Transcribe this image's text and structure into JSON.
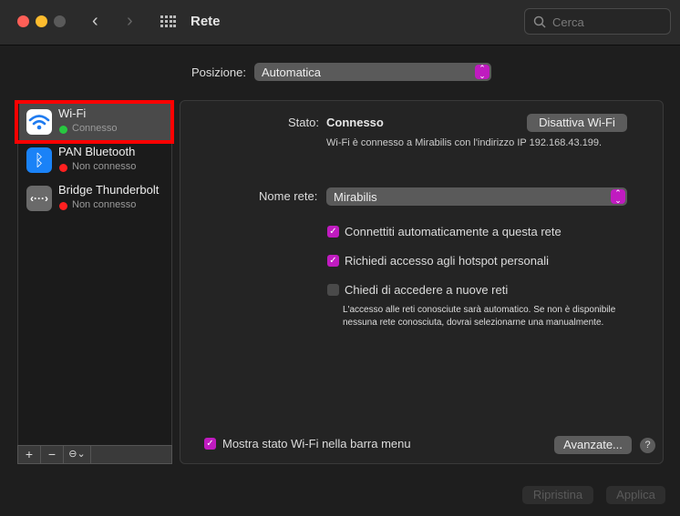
{
  "window": {
    "title": "Rete",
    "search_placeholder": "Cerca"
  },
  "location": {
    "label": "Posizione:",
    "value": "Automatica"
  },
  "services": [
    {
      "name": "Wi-Fi",
      "status": "Connesso",
      "status_color": "#28c840"
    },
    {
      "name": "PAN Bluetooth",
      "status": "Non connesso",
      "status_color": "#ff2020"
    },
    {
      "name": "Bridge Thunderbolt",
      "status": "Non connesso",
      "status_color": "#ff2020"
    }
  ],
  "sidebar_toolbar": {
    "add": "+",
    "remove": "−",
    "action": "⊖⌄"
  },
  "detail": {
    "status_label": "Stato:",
    "status_value": "Connesso",
    "toggle_button": "Disattiva Wi-Fi",
    "status_description": "Wi-Fi è connesso a Mirabilis con l'indirizzo IP 192.168.43.199.",
    "network_label": "Nome rete:",
    "network_value": "Mirabilis",
    "checkboxes": [
      {
        "label": "Connettiti automaticamente a questa rete",
        "checked": true
      },
      {
        "label": "Richiedi accesso agli hotspot personali",
        "checked": true
      },
      {
        "label": "Chiedi di accedere a nuove reti",
        "checked": false
      }
    ],
    "hint": "L'accesso alle reti conosciute sarà automatico. Se non è disponibile nessuna rete conosciuta, dovrai selezionarne una manualmente.",
    "menu_bar_checkbox": "Mostra stato Wi-Fi nella barra menu",
    "advanced_button": "Avanzate...",
    "help": "?"
  },
  "footer": {
    "revert": "Ripristina",
    "apply": "Applica"
  },
  "accent": "#c01bc0"
}
